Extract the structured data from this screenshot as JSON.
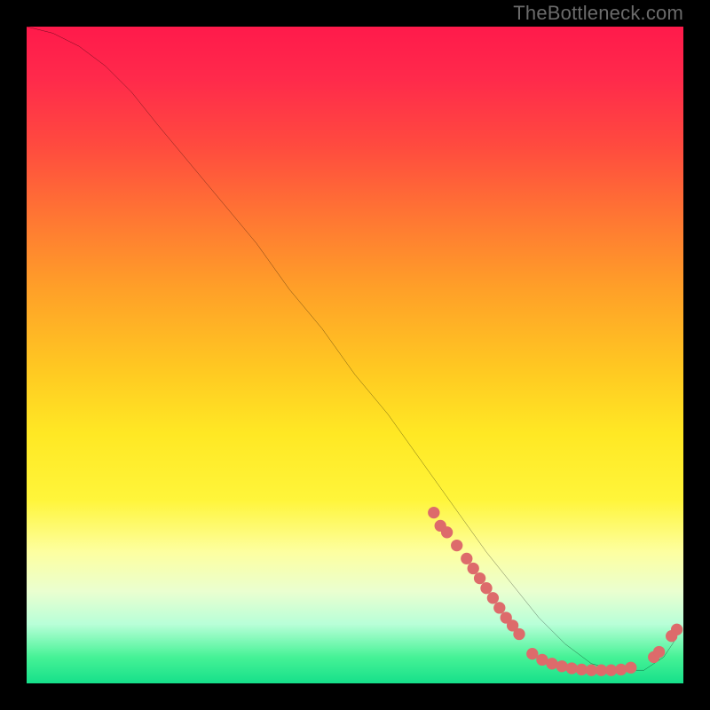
{
  "watermark": "TheBottleneck.com",
  "chart_data": {
    "type": "line",
    "title": "",
    "xlabel": "",
    "ylabel": "",
    "xlim": [
      0,
      100
    ],
    "ylim": [
      0,
      100
    ],
    "grid": false,
    "series": [
      {
        "name": "bottleneck-curve",
        "x": [
          0,
          4,
          8,
          12,
          16,
          20,
          25,
          30,
          35,
          40,
          45,
          50,
          55,
          60,
          65,
          70,
          74,
          78,
          82,
          86,
          90,
          94,
          97,
          99
        ],
        "y": [
          100,
          99,
          97,
          94,
          90,
          85,
          79,
          73,
          67,
          60,
          54,
          47,
          41,
          34,
          27,
          20,
          15,
          10,
          6,
          3,
          2,
          2,
          4,
          7
        ],
        "color": "#000000"
      }
    ],
    "markers": [
      {
        "series": "dots-descent",
        "color": "#dd6b6b",
        "points": [
          {
            "x": 62,
            "y": 26
          },
          {
            "x": 63,
            "y": 24
          },
          {
            "x": 64,
            "y": 23
          },
          {
            "x": 65.5,
            "y": 21
          },
          {
            "x": 67,
            "y": 19
          },
          {
            "x": 68,
            "y": 17.5
          },
          {
            "x": 69,
            "y": 16
          },
          {
            "x": 70,
            "y": 14.5
          },
          {
            "x": 71,
            "y": 13
          },
          {
            "x": 72,
            "y": 11.5
          },
          {
            "x": 73,
            "y": 10
          },
          {
            "x": 74,
            "y": 8.8
          },
          {
            "x": 75,
            "y": 7.5
          }
        ]
      },
      {
        "series": "dots-valley",
        "color": "#dd6b6b",
        "points": [
          {
            "x": 77,
            "y": 4.5
          },
          {
            "x": 78.5,
            "y": 3.6
          },
          {
            "x": 80,
            "y": 3.0
          },
          {
            "x": 81.5,
            "y": 2.6
          },
          {
            "x": 83,
            "y": 2.3
          },
          {
            "x": 84.5,
            "y": 2.1
          },
          {
            "x": 86,
            "y": 2.0
          },
          {
            "x": 87.5,
            "y": 2.0
          },
          {
            "x": 89,
            "y": 2.0
          },
          {
            "x": 90.5,
            "y": 2.1
          },
          {
            "x": 92,
            "y": 2.4
          }
        ]
      },
      {
        "series": "dots-rise",
        "color": "#dd6b6b",
        "points": [
          {
            "x": 95.5,
            "y": 4.0
          },
          {
            "x": 96.3,
            "y": 4.8
          },
          {
            "x": 98.2,
            "y": 7.2
          },
          {
            "x": 99.0,
            "y": 8.2
          }
        ]
      }
    ],
    "gradient_stops": [
      {
        "pos": 0.0,
        "color": "#ff1a4b"
      },
      {
        "pos": 0.3,
        "color": "#ff7a32"
      },
      {
        "pos": 0.62,
        "color": "#ffe824"
      },
      {
        "pos": 0.86,
        "color": "#eaffd0"
      },
      {
        "pos": 1.0,
        "color": "#16e08a"
      }
    ]
  }
}
